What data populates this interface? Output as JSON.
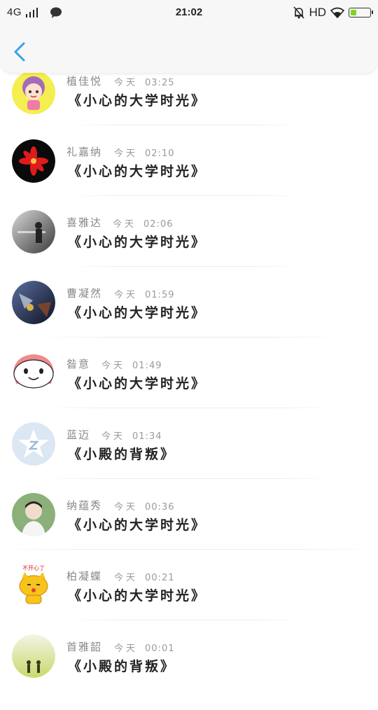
{
  "status_bar": {
    "network": "4G",
    "time": "21:02",
    "hd": "HD",
    "battery_level": 0.3,
    "icons": [
      "signal-bars-icon",
      "chat-bubble-icon",
      "mute-bell-icon",
      "wifi-icon",
      "battery-icon"
    ]
  },
  "header": {
    "back_icon": "chevron-left-icon",
    "accent": "#3aa0e8"
  },
  "items": [
    {
      "name": "植佳悦",
      "day": "今天",
      "time": "03:25",
      "message": "《小心的大学时光》"
    },
    {
      "name": "礼嘉纳",
      "day": "今天",
      "time": "02:10",
      "message": "《小心的大学时光》"
    },
    {
      "name": "喜雅达",
      "day": "今天",
      "time": "02:06",
      "message": "《小心的大学时光》"
    },
    {
      "name": "曹凝然",
      "day": "今天",
      "time": "01:59",
      "message": "《小心的大学时光》"
    },
    {
      "name": "昝意",
      "day": "今天",
      "time": "01:49",
      "message": "《小心的大学时光》"
    },
    {
      "name": "蓝迈",
      "day": "今天",
      "time": "01:34",
      "message": "《小殿的背叛》"
    },
    {
      "name": "纳蕴秀",
      "day": "今天",
      "time": "00:36",
      "message": "《小心的大学时光》"
    },
    {
      "name": "柏凝蝶",
      "day": "今天",
      "time": "00:21",
      "message": "《小心的大学时光》"
    },
    {
      "name": "首雅韶",
      "day": "今天",
      "time": "00:01",
      "message": "《小殿的背叛》"
    }
  ],
  "sticker_text": "不开心了"
}
